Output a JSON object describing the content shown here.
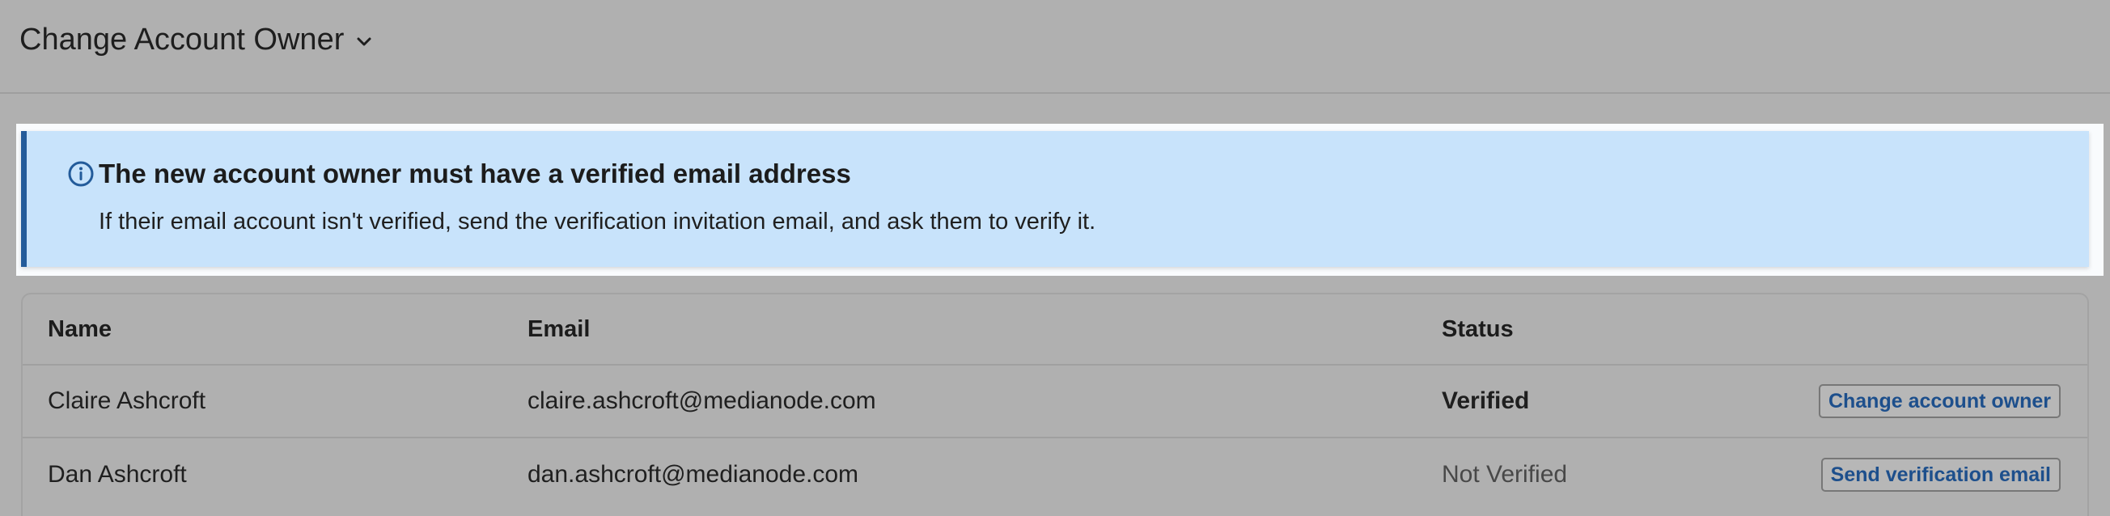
{
  "header": {
    "title": "Change Account Owner",
    "dropdown_icon": "chevron-down-icon"
  },
  "banner": {
    "icon": "info-circle-icon",
    "title": "The new account owner must have a verified email address",
    "body": "If their email account isn't verified, send the verification invitation email, and ask them to verify it.",
    "background_color": "#c8e3fb",
    "accent_color": "#235b9a"
  },
  "table": {
    "columns": [
      "Name",
      "Email",
      "Status"
    ],
    "rows": [
      {
        "name": "Claire Ashcroft",
        "email": "claire.ashcroft@medianode.com",
        "status": "Verified",
        "action": "Change account owner"
      },
      {
        "name": "Dan Ashcroft",
        "email": "dan.ashcroft@medianode.com",
        "status": "Not Verified",
        "action": "Send verification email"
      }
    ]
  },
  "colors": {
    "page_background": "#b0b0b0",
    "link_blue": "#1d4f8c"
  }
}
